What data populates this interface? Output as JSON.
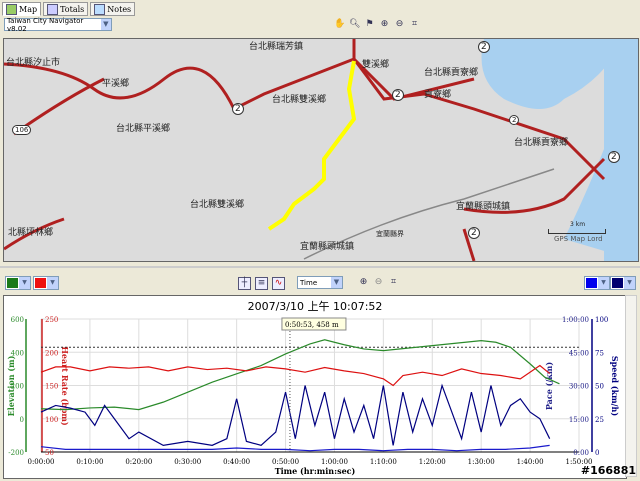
{
  "tabs": [
    {
      "label": "Map"
    },
    {
      "label": "Totals"
    },
    {
      "label": "Notes"
    }
  ],
  "map_source": "Taiwan City Navigator v8.02",
  "map_labels": [
    "台北縣瑞芳鎮",
    "雙溪鄉",
    "台北縣汐止市",
    "平溪鄉",
    "台北縣雙溪鄉",
    "台北縣貢寮鄉",
    "貢寮鄉",
    "台北縣平溪鄉",
    "台北縣貢寮鄉",
    "台北縣雙溪鄉",
    "宜蘭縣頭城鎮",
    "北縣坪林鄉",
    "宜蘭縣界",
    "宜蘭縣頭城鎮"
  ],
  "road_numbers": [
    "2",
    "2",
    "2",
    "106",
    "2",
    "2",
    "2"
  ],
  "scale": {
    "label": "3 km",
    "credit": "GPS Map Lord"
  },
  "x_axis_select": "Time",
  "chart_data": {
    "type": "line",
    "title": "2007/3/10 上午 10:07:52",
    "xlabel": "Time (hr:min:sec)",
    "x_ticks": [
      "0:00:00",
      "0:10:00",
      "0:20:00",
      "0:30:00",
      "0:40:00",
      "0:50:00",
      "1:00:00",
      "1:10:00",
      "1:20:00",
      "1:30:00",
      "1:40:00",
      "1:50:00"
    ],
    "xlim": [
      0,
      110
    ],
    "axes": {
      "elevation": {
        "label": "Elevation (m)",
        "ticks": [
          "600",
          "400",
          "200",
          "0",
          "-200"
        ],
        "ylim": [
          -200,
          600
        ],
        "color": "#2a8a2a"
      },
      "heart_rate": {
        "label": "Heart Rate (bpm)",
        "ticks": [
          "250",
          "200",
          "150",
          "100",
          "50"
        ],
        "ylim": [
          50,
          250
        ],
        "color": "#cc2222"
      },
      "pace": {
        "label": "Pace (/km)",
        "ticks": [
          "1:00:00",
          "45:00",
          "30:00",
          "15:00",
          "0:00"
        ],
        "color": "#22228a"
      },
      "speed": {
        "label": "Speed (km/h)",
        "ticks": [
          "100",
          "75",
          "50",
          "25",
          "0"
        ],
        "ylim": [
          0,
          100
        ],
        "color": "#000080"
      }
    },
    "cursor": {
      "label": "0:50:53, 458 m",
      "x": 50.9
    },
    "max_line_elevation": 430,
    "series": [
      {
        "name": "Elevation",
        "axis": "elevation",
        "color": "#2a8a2a",
        "x": [
          0,
          5,
          10,
          15,
          20,
          25,
          30,
          35,
          40,
          45,
          50,
          55,
          58,
          62,
          66,
          70,
          75,
          80,
          85,
          90,
          93,
          96,
          100,
          103,
          106
        ],
        "values": [
          60,
          55,
          65,
          70,
          55,
          100,
          160,
          220,
          270,
          320,
          390,
          450,
          475,
          445,
          420,
          410,
          425,
          440,
          455,
          470,
          460,
          430,
          330,
          250,
          210
        ]
      },
      {
        "name": "Heart Rate",
        "axis": "heart_rate",
        "color": "#dd1111",
        "x": [
          0,
          3,
          6,
          10,
          14,
          18,
          22,
          26,
          30,
          34,
          38,
          42,
          46,
          50,
          54,
          58,
          62,
          66,
          70,
          72,
          74,
          78,
          82,
          86,
          90,
          94,
          98,
          102,
          104
        ],
        "values": [
          170,
          178,
          178,
          172,
          178,
          176,
          178,
          172,
          178,
          174,
          176,
          172,
          178,
          175,
          170,
          177,
          172,
          168,
          160,
          150,
          165,
          170,
          165,
          175,
          168,
          165,
          160,
          180,
          168
        ]
      },
      {
        "name": "Speed",
        "axis": "speed",
        "color": "#000080",
        "x": [
          0,
          3,
          6,
          9,
          11,
          13,
          15,
          18,
          20,
          25,
          30,
          35,
          38,
          40,
          42,
          45,
          48,
          50,
          52,
          54,
          56,
          58,
          60,
          62,
          64,
          66,
          68,
          70,
          72,
          74,
          76,
          78,
          80,
          82,
          84,
          86,
          88,
          90,
          92,
          94,
          96,
          98,
          100,
          102,
          104
        ],
        "values": [
          30,
          35,
          33,
          30,
          20,
          35,
          25,
          10,
          15,
          5,
          8,
          5,
          10,
          40,
          8,
          5,
          15,
          45,
          10,
          50,
          20,
          45,
          10,
          40,
          15,
          35,
          10,
          50,
          5,
          45,
          15,
          40,
          20,
          50,
          30,
          10,
          45,
          15,
          50,
          20,
          35,
          40,
          30,
          25,
          10
        ]
      },
      {
        "name": "Pace",
        "axis": "pace",
        "color": "#1a1acc",
        "x": [
          0,
          5,
          10,
          15,
          20,
          25,
          30,
          35,
          40,
          45,
          50,
          55,
          60,
          65,
          70,
          75,
          80,
          85,
          90,
          95,
          100,
          104
        ],
        "values": [
          4,
          2,
          2,
          2,
          2,
          2,
          2,
          2,
          3,
          2,
          2,
          1,
          2,
          2,
          1,
          2,
          2,
          1,
          2,
          2,
          3,
          5
        ]
      }
    ]
  },
  "watermark": "#166881"
}
